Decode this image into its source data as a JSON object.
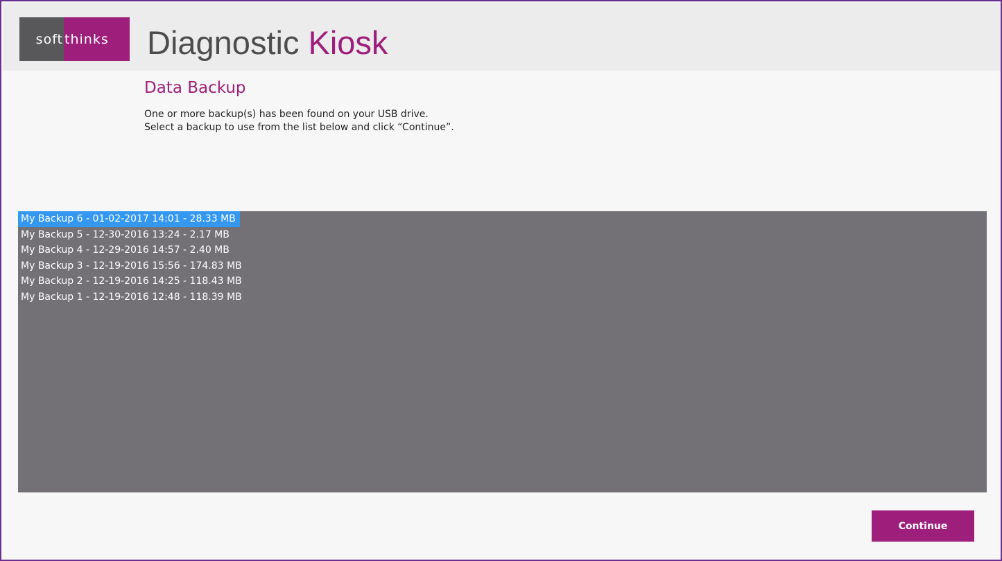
{
  "header": {
    "logo_left": "soft",
    "logo_right": "thinks",
    "title_main": "Diagnostic ",
    "title_accent": "Kiosk"
  },
  "page": {
    "title": "Data Backup",
    "instruction_line1": "One or more backup(s) has been found on your USB drive.",
    "instruction_line2": "Select a backup to use from the list below and click “Continue”."
  },
  "backups": {
    "selected_index": 0,
    "items": [
      "My Backup 6 - 01-02-2017 14:01 - 28.33 MB",
      "My Backup 5 - 12-30-2016 13:24 - 2.17 MB",
      "My Backup 4 - 12-29-2016 14:57 - 2.40 MB",
      "My Backup 3 - 12-19-2016 15:56 - 174.83 MB",
      "My Backup 2 - 12-19-2016 14:25 - 118.43 MB",
      "My Backup 1 - 12-19-2016 12:48 - 118.39 MB"
    ]
  },
  "actions": {
    "continue_label": "Continue"
  },
  "colors": {
    "accent": "#9e1f7b",
    "logo_gray": "#58585a",
    "list_background": "#737176",
    "selection": "#3498f0",
    "frame_border": "#6b2f91"
  }
}
